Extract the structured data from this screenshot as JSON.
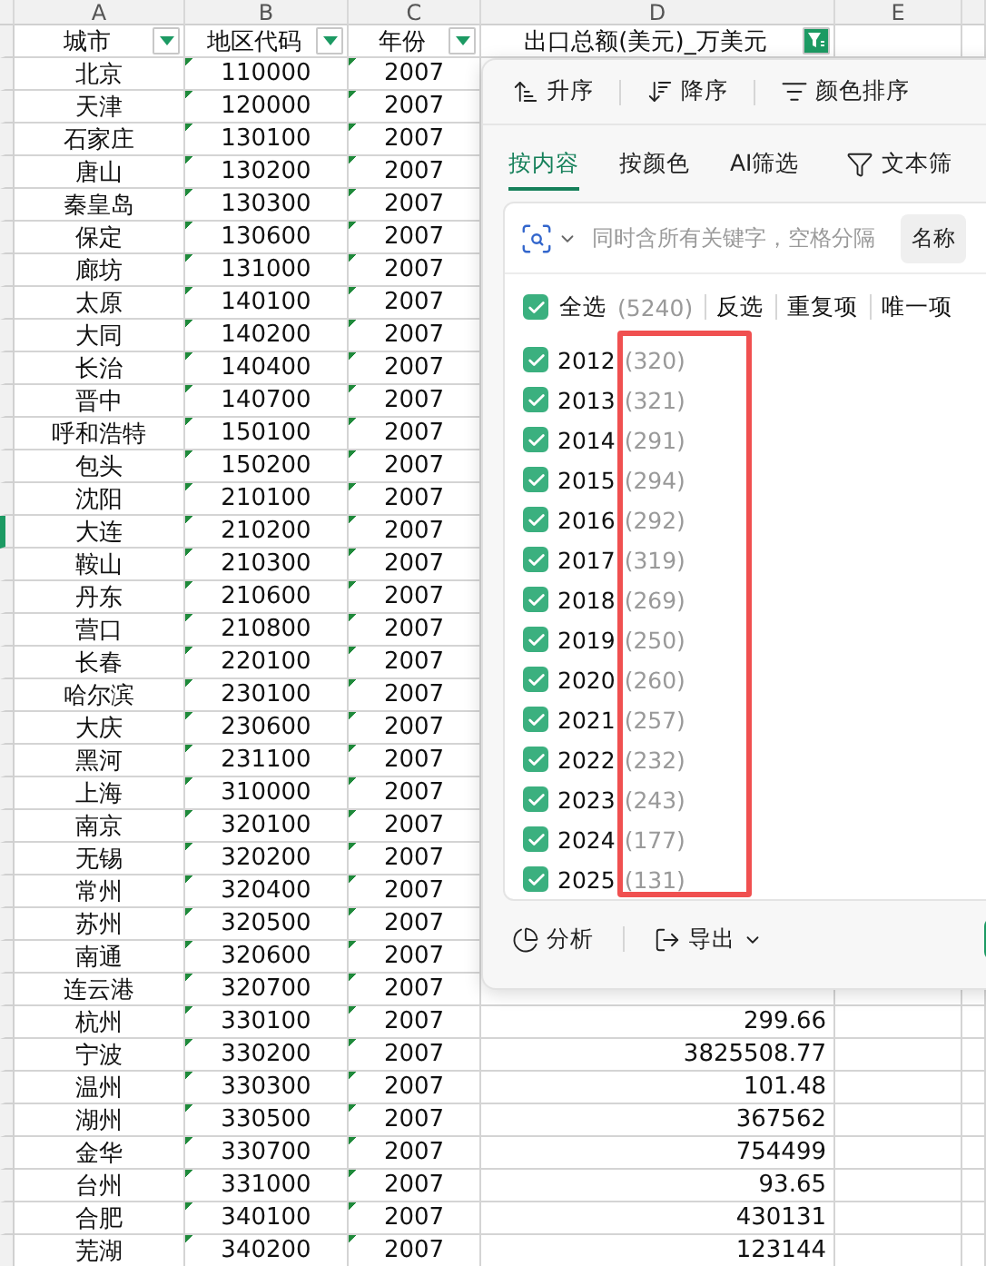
{
  "sheet": {
    "column_letters": [
      "A",
      "B",
      "C",
      "D",
      "E"
    ],
    "header": [
      {
        "label": "城市",
        "filtered": false
      },
      {
        "label": "地区代码",
        "filtered": false
      },
      {
        "label": "年份",
        "filtered": false
      },
      {
        "label": "出口总额(美元)_万美元",
        "filtered": true
      }
    ],
    "rows": [
      {
        "city": "北京",
        "code": "110000",
        "year": "2007",
        "flagged": true,
        "selected": false
      },
      {
        "city": "天津",
        "code": "120000",
        "year": "2007",
        "flagged": true,
        "selected": false
      },
      {
        "city": "石家庄",
        "code": "130100",
        "year": "2007",
        "flagged": true,
        "selected": false
      },
      {
        "city": "唐山",
        "code": "130200",
        "year": "2007",
        "flagged": true,
        "selected": false
      },
      {
        "city": "秦皇岛",
        "code": "130300",
        "year": "2007",
        "flagged": true,
        "selected": false
      },
      {
        "city": "保定",
        "code": "130600",
        "year": "2007",
        "flagged": true,
        "selected": false
      },
      {
        "city": "廊坊",
        "code": "131000",
        "year": "2007",
        "flagged": true,
        "selected": false
      },
      {
        "city": "太原",
        "code": "140100",
        "year": "2007",
        "flagged": true,
        "selected": false
      },
      {
        "city": "大同",
        "code": "140200",
        "year": "2007",
        "flagged": true,
        "selected": false
      },
      {
        "city": "长治",
        "code": "140400",
        "year": "2007",
        "flagged": true,
        "selected": false
      },
      {
        "city": "晋中",
        "code": "140700",
        "year": "2007",
        "flagged": true,
        "selected": false
      },
      {
        "city": "呼和浩特",
        "code": "150100",
        "year": "2007",
        "flagged": true,
        "selected": false
      },
      {
        "city": "包头",
        "code": "150200",
        "year": "2007",
        "flagged": true,
        "selected": false
      },
      {
        "city": "沈阳",
        "code": "210100",
        "year": "2007",
        "flagged": true,
        "selected": false
      },
      {
        "city": "大连",
        "code": "210200",
        "year": "2007",
        "flagged": true,
        "selected": true
      },
      {
        "city": "鞍山",
        "code": "210300",
        "year": "2007",
        "flagged": true,
        "selected": false
      },
      {
        "city": "丹东",
        "code": "210600",
        "year": "2007",
        "flagged": true,
        "selected": false
      },
      {
        "city": "营口",
        "code": "210800",
        "year": "2007",
        "flagged": true,
        "selected": false
      },
      {
        "city": "长春",
        "code": "220100",
        "year": "2007",
        "flagged": true,
        "selected": false
      },
      {
        "city": "哈尔滨",
        "code": "230100",
        "year": "2007",
        "flagged": true,
        "selected": false
      },
      {
        "city": "大庆",
        "code": "230600",
        "year": "2007",
        "flagged": true,
        "selected": false
      },
      {
        "city": "黑河",
        "code": "231100",
        "year": "2007",
        "flagged": true,
        "selected": false
      },
      {
        "city": "上海",
        "code": "310000",
        "year": "2007",
        "flagged": true,
        "selected": false
      },
      {
        "city": "南京",
        "code": "320100",
        "year": "2007",
        "flagged": true,
        "selected": false
      },
      {
        "city": "无锡",
        "code": "320200",
        "year": "2007",
        "flagged": true,
        "selected": false
      },
      {
        "city": "常州",
        "code": "320400",
        "year": "2007",
        "flagged": true,
        "selected": false
      },
      {
        "city": "苏州",
        "code": "320500",
        "year": "2007",
        "flagged": true,
        "selected": false
      },
      {
        "city": "南通",
        "code": "320600",
        "year": "2007",
        "flagged": true,
        "selected": false
      },
      {
        "city": "连云港",
        "code": "320700",
        "year": "2007",
        "flagged": true,
        "selected": false
      },
      {
        "city": "杭州",
        "code": "330100",
        "year": "2007",
        "amount": "299.66",
        "flagged": true,
        "selected": false
      },
      {
        "city": "宁波",
        "code": "330200",
        "year": "2007",
        "amount": "3825508.77",
        "flagged": true,
        "selected": false
      },
      {
        "city": "温州",
        "code": "330300",
        "year": "2007",
        "amount": "101.48",
        "flagged": true,
        "selected": false
      },
      {
        "city": "湖州",
        "code": "330500",
        "year": "2007",
        "amount": "367562",
        "flagged": true,
        "selected": false
      },
      {
        "city": "金华",
        "code": "330700",
        "year": "2007",
        "amount": "754499",
        "flagged": true,
        "selected": false
      },
      {
        "city": "台州",
        "code": "331000",
        "year": "2007",
        "amount": "93.65",
        "flagged": true,
        "selected": false
      },
      {
        "city": "合肥",
        "code": "340100",
        "year": "2007",
        "amount": "430131",
        "flagged": true,
        "selected": false
      },
      {
        "city": "芜湖",
        "code": "340200",
        "year": "2007",
        "amount": "123144",
        "flagged": true,
        "selected": false
      }
    ]
  },
  "filter_panel": {
    "sort_buttons": [
      {
        "label": "升序",
        "kind": "ascending"
      },
      {
        "label": "降序",
        "kind": "descending"
      },
      {
        "label": "颜色排序",
        "kind": "color"
      }
    ],
    "tabs": [
      {
        "label": "按内容",
        "selected": true
      },
      {
        "label": "按颜色",
        "selected": false
      },
      {
        "label": "AI筛选",
        "selected": false
      }
    ],
    "text_filter": "文本筛",
    "search": {
      "placeholder": "同时含所有关键字，空格分隔"
    },
    "name_button": "名称",
    "select_all": {
      "label": "全选",
      "count": "(5240)",
      "checked": true
    },
    "actions": [
      "反选",
      "重复项",
      "唯一项"
    ],
    "items": [
      {
        "label": "2012",
        "count": "(320)",
        "checked": true
      },
      {
        "label": "2013",
        "count": "(321)",
        "checked": true
      },
      {
        "label": "2014",
        "count": "(291)",
        "checked": true
      },
      {
        "label": "2015",
        "count": "(294)",
        "checked": true
      },
      {
        "label": "2016",
        "count": "(292)",
        "checked": true
      },
      {
        "label": "2017",
        "count": "(319)",
        "checked": true
      },
      {
        "label": "2018",
        "count": "(269)",
        "checked": true
      },
      {
        "label": "2019",
        "count": "(250)",
        "checked": true
      },
      {
        "label": "2020",
        "count": "(260)",
        "checked": true
      },
      {
        "label": "2021",
        "count": "(257)",
        "checked": true
      },
      {
        "label": "2022",
        "count": "(232)",
        "checked": true
      },
      {
        "label": "2023",
        "count": "(243)",
        "checked": true
      },
      {
        "label": "2024",
        "count": "(177)",
        "checked": true
      },
      {
        "label": "2025",
        "count": "(131)",
        "checked": true
      }
    ],
    "footer": [
      {
        "label": "分析",
        "kind": "analyze"
      },
      {
        "label": "导出",
        "kind": "export"
      }
    ]
  }
}
